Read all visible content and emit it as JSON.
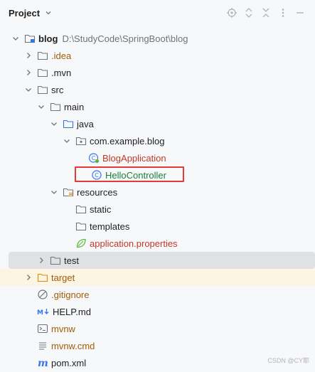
{
  "header": {
    "title": "Project"
  },
  "tree": {
    "root": {
      "label": "blog",
      "path": "D:\\StudyCode\\SpringBoot\\blog"
    },
    "items": [
      {
        "label": ".idea"
      },
      {
        "label": ".mvn"
      },
      {
        "label": "src"
      },
      {
        "label": "main"
      },
      {
        "label": "java"
      },
      {
        "label": "com.example.blog"
      },
      {
        "label": "BlogApplication"
      },
      {
        "label": "HelloController"
      },
      {
        "label": "resources"
      },
      {
        "label": "static"
      },
      {
        "label": "templates"
      },
      {
        "label": "application.properties"
      },
      {
        "label": "test"
      },
      {
        "label": "target"
      },
      {
        "label": ".gitignore"
      },
      {
        "label": "HELP.md"
      },
      {
        "label": "mvnw"
      },
      {
        "label": "mvnw.cmd"
      },
      {
        "label": "pom.xml"
      }
    ]
  },
  "watermark": "CSDN @CY耶",
  "colors": {
    "highlight": "#e53935",
    "selected_row": "#dfe1e5",
    "excluded_row": "#fcf5e3",
    "class_red": "#c0392b",
    "class_green": "#1a7f37"
  }
}
